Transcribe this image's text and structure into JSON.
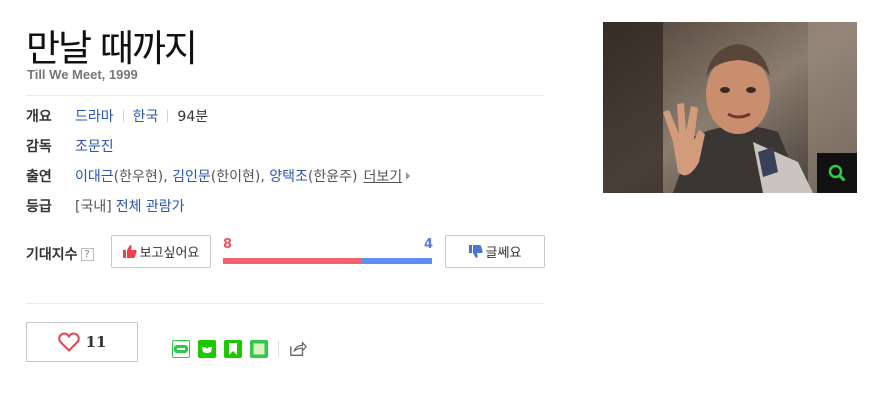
{
  "title": "만날 때까지",
  "subtitle": "Till We Meet, 1999",
  "info": {
    "overview_label": "개요",
    "genre": "드라마",
    "country": "한국",
    "runtime": "94분",
    "director_label": "감독",
    "director": "조문진",
    "cast_label": "출연",
    "cast": [
      {
        "actor": "이대근",
        "role": "(한우현), "
      },
      {
        "actor": "김인문",
        "role": "(한이현), "
      },
      {
        "actor": "양택조",
        "role": "(한윤주)"
      }
    ],
    "more_label": "더보기",
    "rating_label": "등급",
    "rating_prefix": "[국내]",
    "rating": "전체 관람가"
  },
  "expectation": {
    "label": "기대지수",
    "help": "?",
    "like_label": "보고싶어요",
    "dislike_label": "글쎄요",
    "like_count": 8,
    "dislike_count": 4,
    "like_color": "#f2636b",
    "dislike_color": "#5b8ff0"
  },
  "social": {
    "heart_count": "11",
    "heart_color": "#e8424f",
    "share_icons": [
      "blog-icon",
      "cafe-icon",
      "bookmark-icon",
      "memo-icon",
      "share-icon"
    ]
  }
}
